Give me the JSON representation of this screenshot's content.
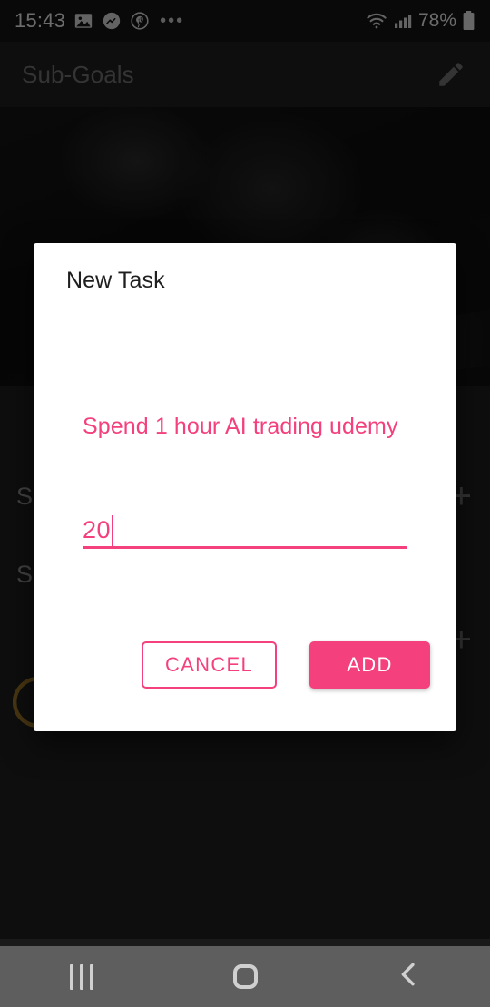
{
  "status_bar": {
    "time": "15:43",
    "icons": [
      "gallery-icon",
      "messenger-icon",
      "pinterest-icon"
    ],
    "overflow": "•••",
    "wifi": "wifi-icon",
    "signal": "cellular-signal-icon",
    "battery_percent": "78%",
    "battery": "battery-icon"
  },
  "app_bar": {
    "title": "Sub-Goals",
    "edit_icon": "pencil-edit-icon"
  },
  "background": {
    "rows": [
      {
        "title": "S",
        "add": "+"
      },
      {
        "title": "S",
        "add": "+"
      }
    ],
    "progress_arc": "circular-progress-arc"
  },
  "dialog": {
    "title": "New Task",
    "field": {
      "label": "Spend 1 hour AI trading udemy",
      "value": "20",
      "caret": "|"
    },
    "cancel_label": "CANCEL",
    "add_label": "ADD"
  },
  "nav_bar": {
    "recents": "recents-icon",
    "home": "home-icon",
    "back": "back-icon"
  },
  "colors": {
    "accent_pink": "#F4407D",
    "dialog_bg": "#FFFFFF",
    "app_bg": "#1E1E1E",
    "status_bg": "#141414",
    "navbar_bg": "#5E5E5E",
    "title_gray": "#6D6D6D",
    "arc_gold": "#9A7326"
  }
}
